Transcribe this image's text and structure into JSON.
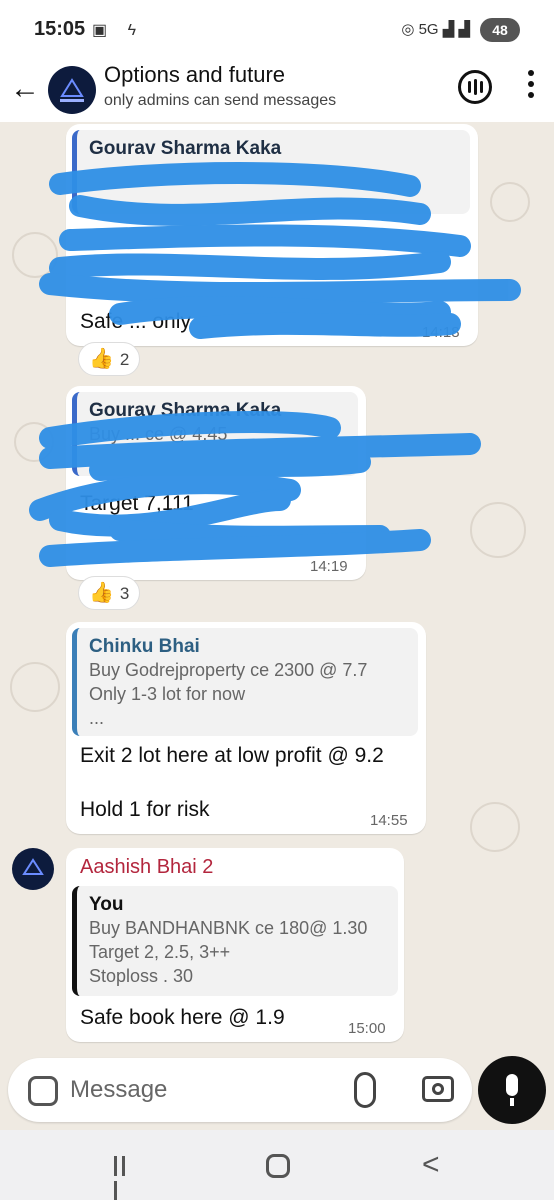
{
  "status_bar": {
    "time": "15:05",
    "network": "5G",
    "battery": "48"
  },
  "header": {
    "title": "Options and future",
    "subtitle": "only admins can send messages"
  },
  "messages": [
    {
      "quote_name": "Gourav Sharma Kaka",
      "quote_name_color": "#1f2f44",
      "text": "Safe ... only",
      "time": "14:18",
      "reaction": "2"
    },
    {
      "quote_name": "Gourav Sharma Kaka",
      "quote_text": "Buy ... ce @ 4.45",
      "text": "Target 7,111",
      "time": "14:19",
      "reaction": "3"
    },
    {
      "quote_name": "Chinku Bhai",
      "quote_lines": [
        "Buy Godrejproperty ce 2300 @ 7.7",
        "Only 1-3 lot for now",
        "..."
      ],
      "text_line1": "Exit 2 lot here at low profit @ 9.2",
      "text_line2": "Hold 1 for risk",
      "time": "14:55"
    },
    {
      "sender": "Aashish Bhai 2",
      "sender_color": "#b3263d",
      "quote_name": "You",
      "quote_lines": [
        "Buy BANDHANBNK ce 180@ 1.30",
        "Target   2, 2.5, 3++",
        "Stoploss  . 30"
      ],
      "text": "Safe book here @ 1.9",
      "time": "15:00"
    }
  ],
  "input": {
    "placeholder": "Message"
  },
  "colors": {
    "accent": "#3b6ac9",
    "scribble": "#2f8fe6",
    "chat_bg": "#efeae2"
  }
}
